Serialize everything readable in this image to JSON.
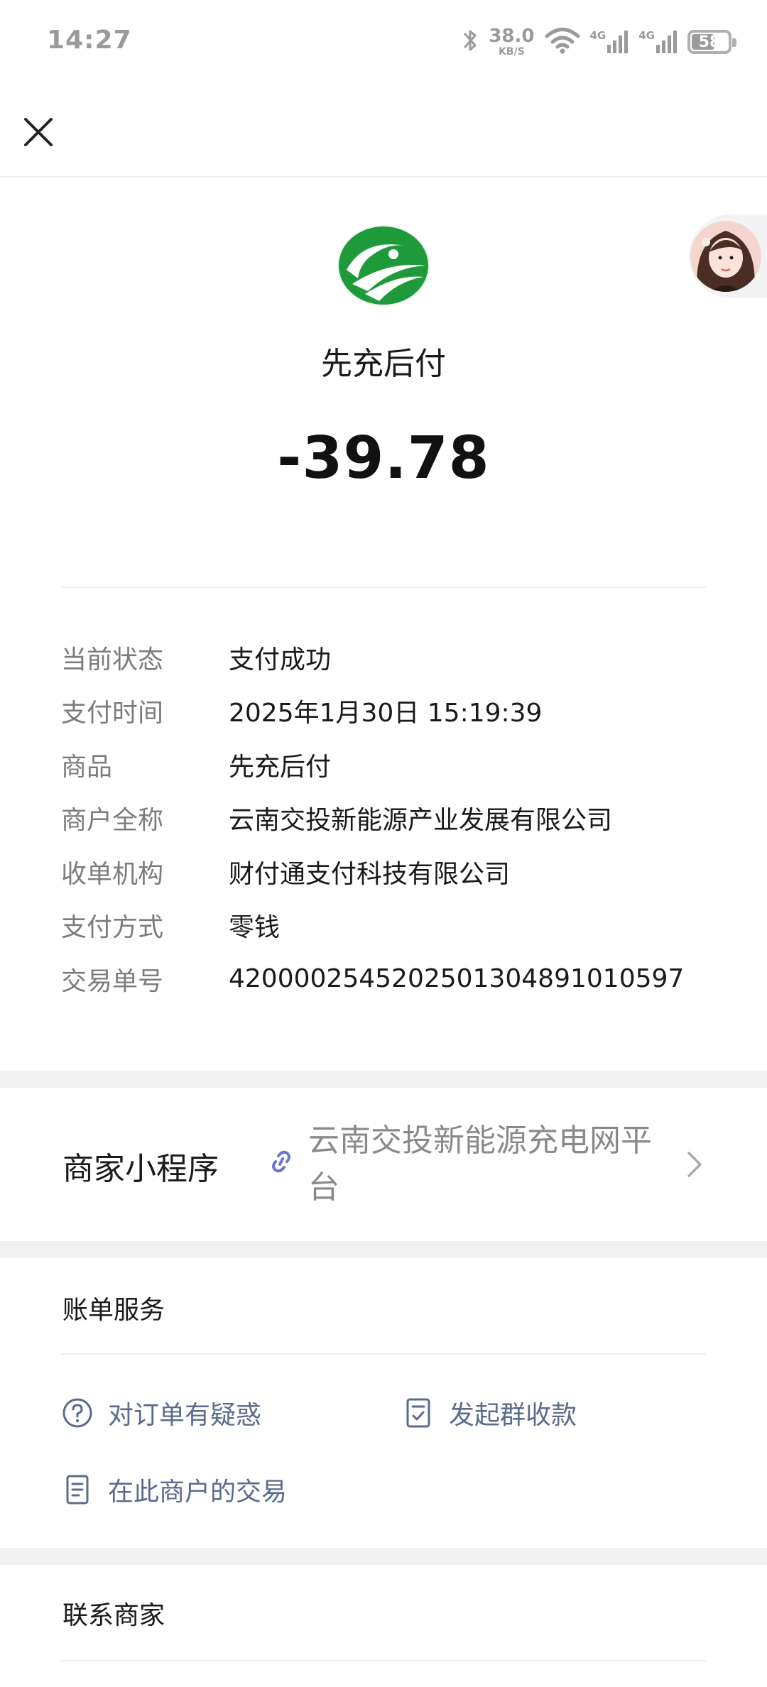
{
  "status_bar": {
    "time": "14:27",
    "net_speed": "38.0",
    "net_speed_unit": "KB/S",
    "signal_1_label": "4G",
    "signal_2_label": "4G",
    "battery": "58"
  },
  "header": {
    "merchant_name": "先充后付",
    "amount": "-39.78"
  },
  "details": [
    {
      "key": "当前状态",
      "value": "支付成功"
    },
    {
      "key": "支付时间",
      "value": "2025年1月30日 15:19:39"
    },
    {
      "key": "商品",
      "value": "先充后付"
    },
    {
      "key": "商户全称",
      "value": "云南交投新能源产业发展有限公司"
    },
    {
      "key": "收单机构",
      "value": "财付通支付科技有限公司"
    },
    {
      "key": "支付方式",
      "value": "零钱"
    },
    {
      "key": "交易单号",
      "value": "4200002545202501304891010597"
    }
  ],
  "mini_program": {
    "label": "商家小程序",
    "value": "云南交投新能源充电网平台"
  },
  "bill_services": {
    "title": "账单服务",
    "items": [
      {
        "label": "对订单有疑惑",
        "icon": "question-circle-icon"
      },
      {
        "label": "发起群收款",
        "icon": "checklist-icon"
      },
      {
        "label": "在此商户的交易",
        "icon": "document-icon"
      }
    ]
  },
  "contact": {
    "title": "联系商家"
  },
  "colors": {
    "link_text": "#5a6b8c",
    "logo_green": "#1f9a3a",
    "mini_link_icon": "#6a74d8",
    "background_band": "#f2f2f2"
  }
}
